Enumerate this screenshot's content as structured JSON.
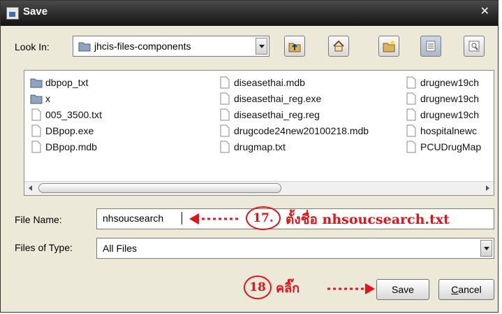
{
  "window": {
    "title": "Save"
  },
  "look_in": {
    "label": "Look In:",
    "value": "jhcis-files-components"
  },
  "toolbar": {
    "icons": [
      "up-folder-icon",
      "home-icon",
      "new-folder-icon",
      "list-view-icon",
      "details-view-icon"
    ]
  },
  "files": [
    {
      "name": "dbpop_txt",
      "type": "folder"
    },
    {
      "name": "x",
      "type": "folder"
    },
    {
      "name": "005_3500.txt",
      "type": "file"
    },
    {
      "name": "DBpop.exe",
      "type": "file"
    },
    {
      "name": "DBpop.mdb",
      "type": "file"
    },
    {
      "name": "diseasethai.mdb",
      "type": "file"
    },
    {
      "name": "diseasethai_reg.exe",
      "type": "file"
    },
    {
      "name": "diseasethai_reg.reg",
      "type": "file"
    },
    {
      "name": "drugcode24new20100218.mdb",
      "type": "file"
    },
    {
      "name": "drugmap.txt",
      "type": "file"
    },
    {
      "name": "drugnew19ch",
      "type": "file"
    },
    {
      "name": "drugnew19ch",
      "type": "file"
    },
    {
      "name": "drugnew19ch",
      "type": "file"
    },
    {
      "name": "hospitalnewc",
      "type": "file"
    },
    {
      "name": "PCUDrugMap",
      "type": "file"
    }
  ],
  "file_name": {
    "label": "File Name:",
    "value": "nhsoucsearch"
  },
  "files_of_type": {
    "label": "Files of Type:",
    "value": "All Files"
  },
  "annotations": {
    "step17_number": "17.",
    "step17_text": "ตั้งชื่อ nhsoucsearch.txt",
    "step18_number": "18",
    "step18_text": "คลิ๊ก"
  },
  "buttons": {
    "save": "Save",
    "cancel_mnemonic": "C",
    "cancel_rest": "ancel"
  },
  "colors": {
    "annotation": "#e0141b",
    "titlebar": "#1e1e1e",
    "dialog_bg": "#ece9d8"
  }
}
